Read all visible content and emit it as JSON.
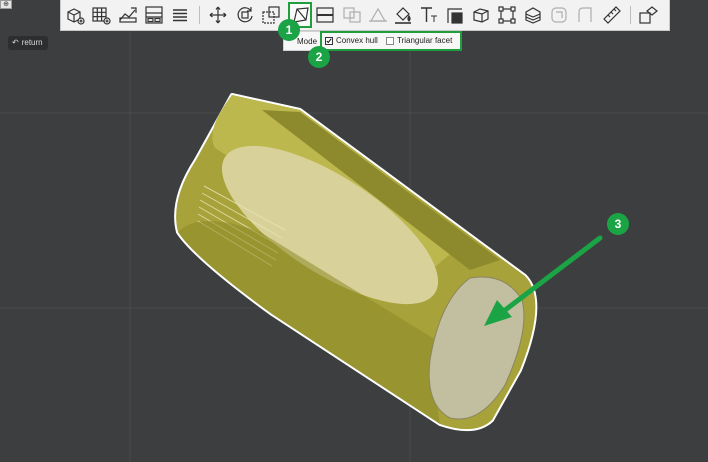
{
  "top_bar": {
    "return_label": "return",
    "corner_glyph": "⊕"
  },
  "toolbar": {
    "tools": [
      "add-cube-icon",
      "grid-add-icon",
      "shape-edit-icon",
      "layout-panel-icon",
      "stack-lines-icon",
      "move-icon",
      "rotate-icon",
      "scale-icon",
      "hull-facet-icon",
      "split-icon",
      "subtract-icon",
      "union-icon",
      "paint-bucket-icon",
      "text-icon",
      "corner-icon",
      "box-icon",
      "bounding-box-icon",
      "layers-icon",
      "undo-shape-icon",
      "ruler-icon",
      "ungroup-icon"
    ]
  },
  "mode_panel": {
    "mode_label": "Mode",
    "options": [
      {
        "label": "Convex hull",
        "checked": true
      },
      {
        "label": "Triangular facet",
        "checked": false
      }
    ]
  },
  "annotations": {
    "marker_1": "1",
    "marker_2": "2",
    "marker_3": "3"
  },
  "colors": {
    "accent_green": "#1aa445",
    "viewport_bg": "#3d3e40",
    "model_olive": "#b5ad3f"
  }
}
